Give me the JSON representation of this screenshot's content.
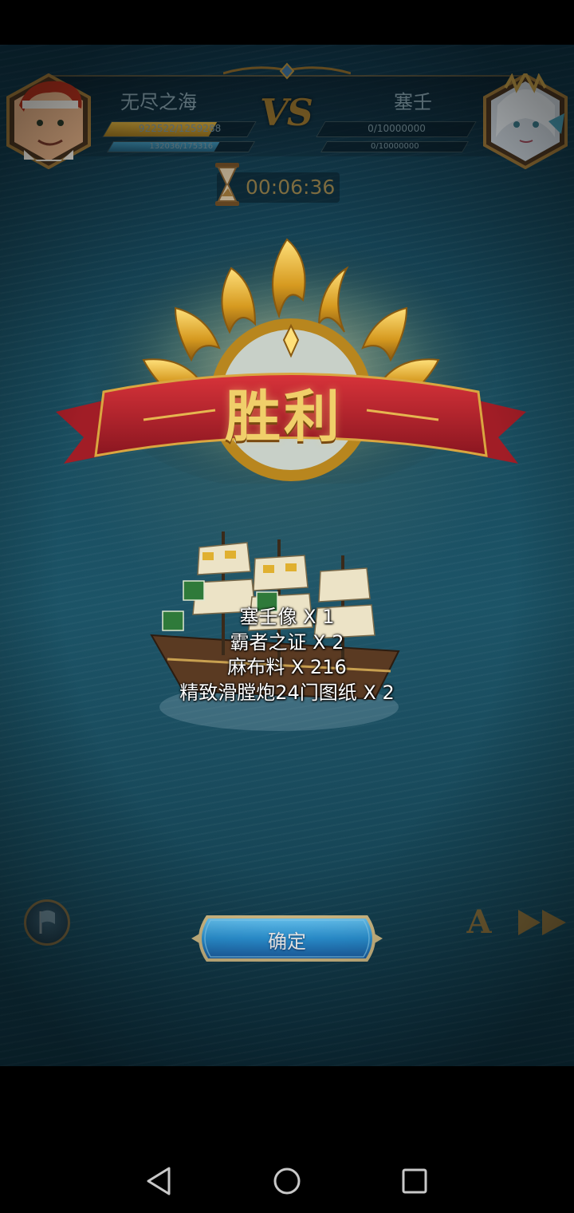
{
  "hud": {
    "left_player": {
      "name": "无尽之海",
      "hp_text": "922522/1259288",
      "hp_fraction": 0.733,
      "sub_text": "132036/175316",
      "sub_fraction": 0.753
    },
    "right_player": {
      "name": "塞壬",
      "hp_text": "0/10000000",
      "hp_fraction": 0.0,
      "sub_text": "0/10000000",
      "sub_fraction": 0.0
    },
    "vs_label": "VS",
    "timer": "00:06:36"
  },
  "result": {
    "title": "胜利"
  },
  "rewards": [
    "塞壬像 X 1",
    "霸者之证 X 2",
    "麻布料 X 216",
    "精致滑膛炮24门图纸 X 2"
  ],
  "controls": {
    "confirm_label": "确定",
    "auto_label": "A"
  },
  "colors": {
    "hp_bar_gold": "#b8932e",
    "sub_bar_blue": "#2f6f8a",
    "button_blue": "#2d9be0",
    "victory_gold": "#f0cf6a",
    "ribbon_red": "#b3222a"
  },
  "icons": {
    "hourglass": "hourglass-icon",
    "flag": "flag-icon",
    "fast_forward": "fast-forward-icon",
    "nav_back": "back-triangle-icon",
    "nav_home": "home-circle-icon",
    "nav_recent": "recent-square-icon"
  }
}
